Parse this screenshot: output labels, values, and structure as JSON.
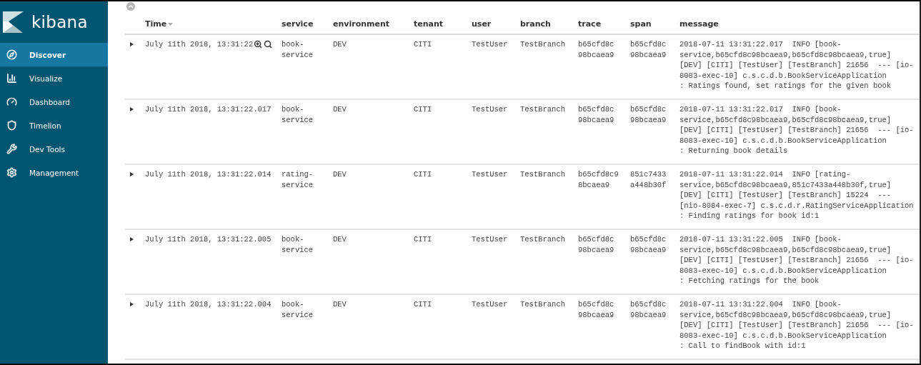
{
  "brand": {
    "name": "kibana"
  },
  "sidebar": {
    "items": [
      {
        "label": "Discover",
        "selected": true
      },
      {
        "label": "Visualize",
        "selected": false
      },
      {
        "label": "Dashboard",
        "selected": false
      },
      {
        "label": "Timelion",
        "selected": false
      },
      {
        "label": "Dev Tools",
        "selected": false
      },
      {
        "label": "Management",
        "selected": false
      }
    ]
  },
  "table": {
    "columns": [
      {
        "label": "Time",
        "sorted": true
      },
      {
        "label": "service",
        "sorted": false
      },
      {
        "label": "environment",
        "sorted": false
      },
      {
        "label": "tenant",
        "sorted": false
      },
      {
        "label": "user",
        "sorted": false
      },
      {
        "label": "branch",
        "sorted": false
      },
      {
        "label": "trace",
        "sorted": false
      },
      {
        "label": "span",
        "sorted": false
      },
      {
        "label": "message",
        "sorted": false
      }
    ],
    "rows": [
      {
        "expanded": false,
        "hovered": true,
        "cells": [
          "July 11th 2018, 13:31:22",
          "book-\nservice",
          "DEV",
          "CITI",
          "TestUser",
          "TestBranch",
          "b65cfd8c\n98bcaea9",
          "b65cfd8c\n98bcaea9",
          "2018-07-11 13:31:22.017  INFO [book-\nservice,b65cfd8c98bcaea9,b65cfd8c98bcaea9,true]\n[DEV] [CITI] [TestUser] [TestBranch] 21656  --- [io-\n8083-exec-10] c.s.c.d.b.BookServiceApplication\n: Ratings found, set ratings for the given book"
        ]
      },
      {
        "expanded": false,
        "hovered": false,
        "cells": [
          "July 11th 2018, 13:31:22.017",
          "book-\nservice",
          "DEV",
          "CITI",
          "TestUser",
          "TestBranch",
          "b65cfd8c\n98bcaea9",
          "b65cfd8c\n98bcaea9",
          "2018-07-11 13:31:22.017  INFO [book-\nservice,b65cfd8c98bcaea9,b65cfd8c98bcaea9,true]\n[DEV] [CITI] [TestUser] [TestBranch] 21656  --- [io-\n8083-exec-10] c.s.c.d.b.BookServiceApplication\n: Returning book details"
        ]
      },
      {
        "expanded": false,
        "hovered": false,
        "cells": [
          "July 11th 2018, 13:31:22.014",
          "rating-\nservice",
          "DEV",
          "CITI",
          "TestUser",
          "TestBranch",
          "b65cfd8c9\n8bcaea9",
          "851c7433\na448b30f",
          "2018-07-11 13:31:22.014  INFO [rating-\nservice,b65cfd8c98bcaea9,851c7433a448b30f,true]\n[DEV] [CITI] [TestUser] [TestBranch] 15224  ---\n[nio-8084-exec-7] c.s.c.d.r.RatingServiceApplication\n: Finding ratings for book id:1"
        ]
      },
      {
        "expanded": false,
        "hovered": false,
        "cells": [
          "July 11th 2018, 13:31:22.005",
          "book-\nservice",
          "DEV",
          "CITI",
          "TestUser",
          "TestBranch",
          "b65cfd8c\n98bcaea9",
          "b65cfd8c\n98bcaea9",
          "2018-07-11 13:31:22.005  INFO [book-\nservice,b65cfd8c98bcaea9,b65cfd8c98bcaea9,true]\n[DEV] [CITI] [TestUser] [TestBranch] 21656  --- [io-\n8083-exec-10] c.s.c.d.b.BookServiceApplication\n: Fetching ratings for the book"
        ]
      },
      {
        "expanded": false,
        "hovered": false,
        "cells": [
          "July 11th 2018, 13:31:22.004",
          "book-\nservice",
          "DEV",
          "CITI",
          "TestUser",
          "TestBranch",
          "b65cfd8c\n98bcaea9",
          "b65cfd8c\n98bcaea9",
          "2018-07-11 13:31:22.004  INFO [book-\nservice,b65cfd8c98bcaea9,b65cfd8c98bcaea9,true]\n[DEV] [CITI] [TestUser] [TestBranch] 21656  --- [io-\n8083-exec-10] c.s.c.d.b.BookServiceApplication\n: Call to findBook with id:1"
        ]
      }
    ]
  }
}
